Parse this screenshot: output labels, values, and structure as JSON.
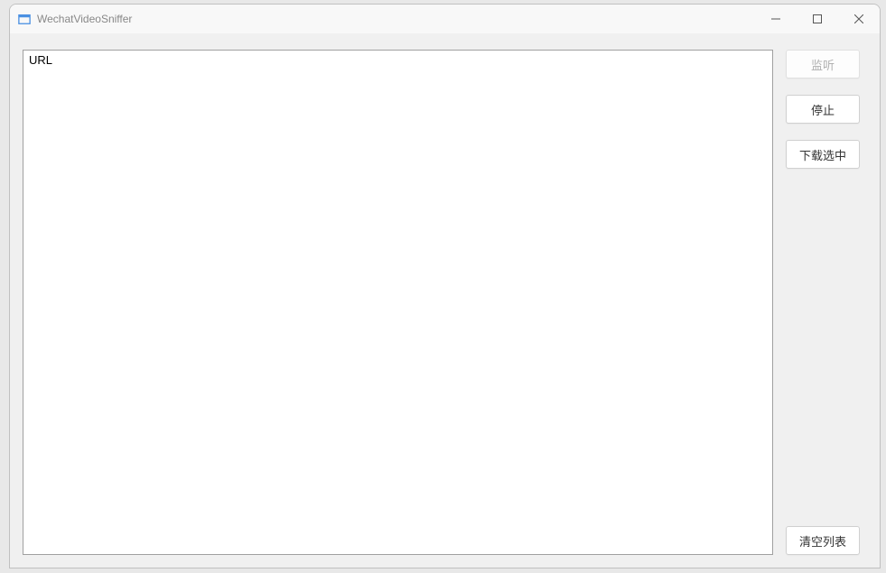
{
  "window": {
    "title": "WechatVideoSniffer"
  },
  "list": {
    "column_header": "URL"
  },
  "buttons": {
    "listen": "监听",
    "stop": "停止",
    "download_selected": "下载选中",
    "clear_list": "清空列表"
  }
}
